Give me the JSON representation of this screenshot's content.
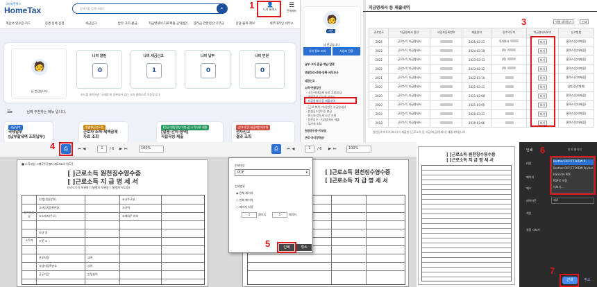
{
  "panel1": {
    "logo_top": "국세청홈택스",
    "logo": "HomeTax",
    "search_placeholder": "검색어를 입력하세요",
    "myhome_label": "나의 홈택스",
    "allmenu_label": "전체메뉴",
    "nav": [
      "계산서·영수증·카드",
      "증명·등록·신청",
      "세금신고",
      "납부·고지·환급",
      "지급명세서·자료제출·공익법인",
      "장려금·연말정산·기부금",
      "상담·불복·제보",
      "세무대리인 세무소"
    ],
    "greeting": "님 반갑습니다.",
    "tiles": [
      {
        "title": "나의 알림",
        "value": "0"
      },
      {
        "title": "나의 세금신고",
        "value": "1"
      },
      {
        "title": "나의 납부",
        "value": "0"
      },
      {
        "title": "나의 민원",
        "value": "0"
      }
    ],
    "notice": "카드를 클릭하면 '국세청'에 등록되어 있는 나의 홈택스로 이동합니다.",
    "recommend": "님께 추천하는 메뉴 입니다.",
    "services": [
      {
        "tag": "세금납부",
        "label": "국세납부\n[납부할세액 조회납부]",
        "color": "#2a6fd1"
      },
      {
        "tag": "맞춤형신고도움",
        "label": "근로자 소득·세액공제\n자료 조회",
        "color": "#c98a1a"
      },
      {
        "tag": "[입금·연말정산·기부금] 소득자료 제출",
        "label": "[일용·간이·용역]\n직접작성 제출",
        "color": "#2a9a62"
      },
      {
        "tag": "신고서 및 세금계산서조회",
        "label": "전자신고\n결과 조회",
        "color": "#d4534a"
      }
    ]
  },
  "panel2": {
    "badge": "개인",
    "greeting": "님 반갑습니다.",
    "tab1": "나의 정보 조회",
    "tab2": "사업자 전환",
    "menu": [
      "납부·고지·환급·체납·압류",
      "연말정산·증명·등록·세무조사",
      "세금신고",
      "소득·연말정산"
    ],
    "submenu": [
      "· 소득·세액공제 자료 조회/발급",
      "· 연말정산 간소화 서비스",
      "· 지급명세서 등 제출내역",
      "· [근로·퇴직·기타]연간 지급명세서",
      "· 원천징수영수증 발급",
      "· 종소세·양도세 신고 조회",
      "· 원천징수 · 지급명세서 제출",
      "· 부가세 조회"
    ],
    "menu2": [
      "현금영수증·기부금",
      "근로·자녀장려금"
    ]
  },
  "panel3": {
    "title": "지급명세서 등 제출내역",
    "excel_btn": "엑셀 내려받기",
    "print_btn": "인쇄",
    "headers": [
      "귀속년도",
      "지급명세서 종류",
      "사업자등록번호",
      "제출일자",
      "징수의무자",
      "지급명세서보기",
      "신고방법"
    ],
    "rows": [
      {
        "year": "2024",
        "kind": "근로소득 지급명세서",
        "date": "2025-02-21",
        "agent": "주식회사",
        "view": "보기",
        "method": "홈택스(전자제출)"
      },
      {
        "year": "2023",
        "kind": "근로소득 지급명세서",
        "date": "2024-02-28",
        "agent": "(주)",
        "view": "보기",
        "method": "홈택스(전자제출)"
      },
      {
        "year": "2022",
        "kind": "근로소득 지급명세서",
        "date": "2023-03-13",
        "agent": "(주)",
        "view": "보기",
        "method": "홈택스(전자제출)"
      },
      {
        "year": "2022",
        "kind": "근로소득 지급명세서",
        "date": "2023-02-22",
        "agent": "(주)",
        "view": "보기",
        "method": "홈택스(전자제출)"
      },
      {
        "year": "2021",
        "kind": "근로소득 지급명세서",
        "date": "2022-03-10",
        "agent": "",
        "view": "보기",
        "method": "홈택스(전자제출)"
      },
      {
        "year": "2020",
        "kind": "근로소득 지급명세서",
        "date": "2021-03-11",
        "agent": "",
        "view": "보기",
        "method": "일반(전산매체)"
      },
      {
        "year": "2020",
        "kind": "근로소득 지급명세서",
        "date": "2021-03-08",
        "agent": "",
        "view": "보기",
        "method": "홈택스(전자제출)"
      },
      {
        "year": "2020",
        "kind": "근로소득 지급명세서",
        "date": "2021-03-05",
        "agent": "",
        "view": "보기",
        "method": "홈택스(전자제출)"
      },
      {
        "year": "2019",
        "kind": "근로소득 지급명세서",
        "date": "2020-03-11",
        "agent": "",
        "view": "보기",
        "method": "홈택스(전자제출)"
      },
      {
        "year": "2018",
        "kind": "근로소득 지급명세서",
        "date": "2019-03-06",
        "agent": "",
        "view": "보기",
        "method": "홈택스(전자제출)"
      }
    ],
    "footnote": "원천징수의무자(회사)가 제출한 [근로소득 등 지급(지급)명세서] 제출내역입니다."
  },
  "viewer": {
    "zoom": "100%",
    "page": "1",
    "of": "/ 6",
    "form_title1": "[ ]근로소득 원천징수영수증",
    "form_title2": "[ ]근로소득 지 급 명 세 서",
    "form_sub": "([√]소득자 보관용 [ ]발행자 보관용 [ ]발행자 보고용)",
    "form_head": "■ 소득세법 시행규칙 [별지 제24호서식(1)]",
    "side_label": "징수의무자",
    "side_label2": "소득자",
    "rows": [
      "①법인명(상호)",
      "③사업자등록번호",
      "⑤소재지(주소)",
      "⑥성 명",
      "⑦주 소",
      "⑧거주구분",
      "⑨국적",
      "⑩세대주 여부"
    ],
    "income": [
      "근무처명",
      "사업자등록번호",
      "근무기간",
      "감면기간",
      "급여",
      "상여",
      "인정상여"
    ]
  },
  "print_dialog": {
    "dest_label": "인쇄대상",
    "dest_value": "PDF",
    "range_label": "인쇄범위",
    "opt1": "전체 페이지",
    "opt2": "현재 페이지",
    "opt3": "페이지 지정",
    "from": "1",
    "to": "5",
    "unit_from": "페이지",
    "unit_to": "페이지",
    "print_btn": "인쇄",
    "cancel_btn": "취소"
  },
  "chrome_print": {
    "title": "인쇄",
    "pages": "총 6 페이지",
    "dest_label": "대상",
    "options": [
      "Brother DCP-T720DW P...",
      "Brother DCP-T720DW Printer",
      "Hancom PDF",
      "PDF로 저장",
      "더보기..."
    ],
    "pages_label": "페이지",
    "copies_label": "매수",
    "layout_label": "레이아웃",
    "layout_value": "세로",
    "color_label": "색상",
    "more_label": "설정 더보기",
    "print_btn": "인쇄",
    "cancel_btn": "취소"
  },
  "steps": [
    "1",
    "2",
    "3",
    "4",
    "5",
    "6",
    "7"
  ],
  "colors": {
    "accent": "#e0161b",
    "brand": "#1d4f9c",
    "btn": "#2a6fd1"
  }
}
